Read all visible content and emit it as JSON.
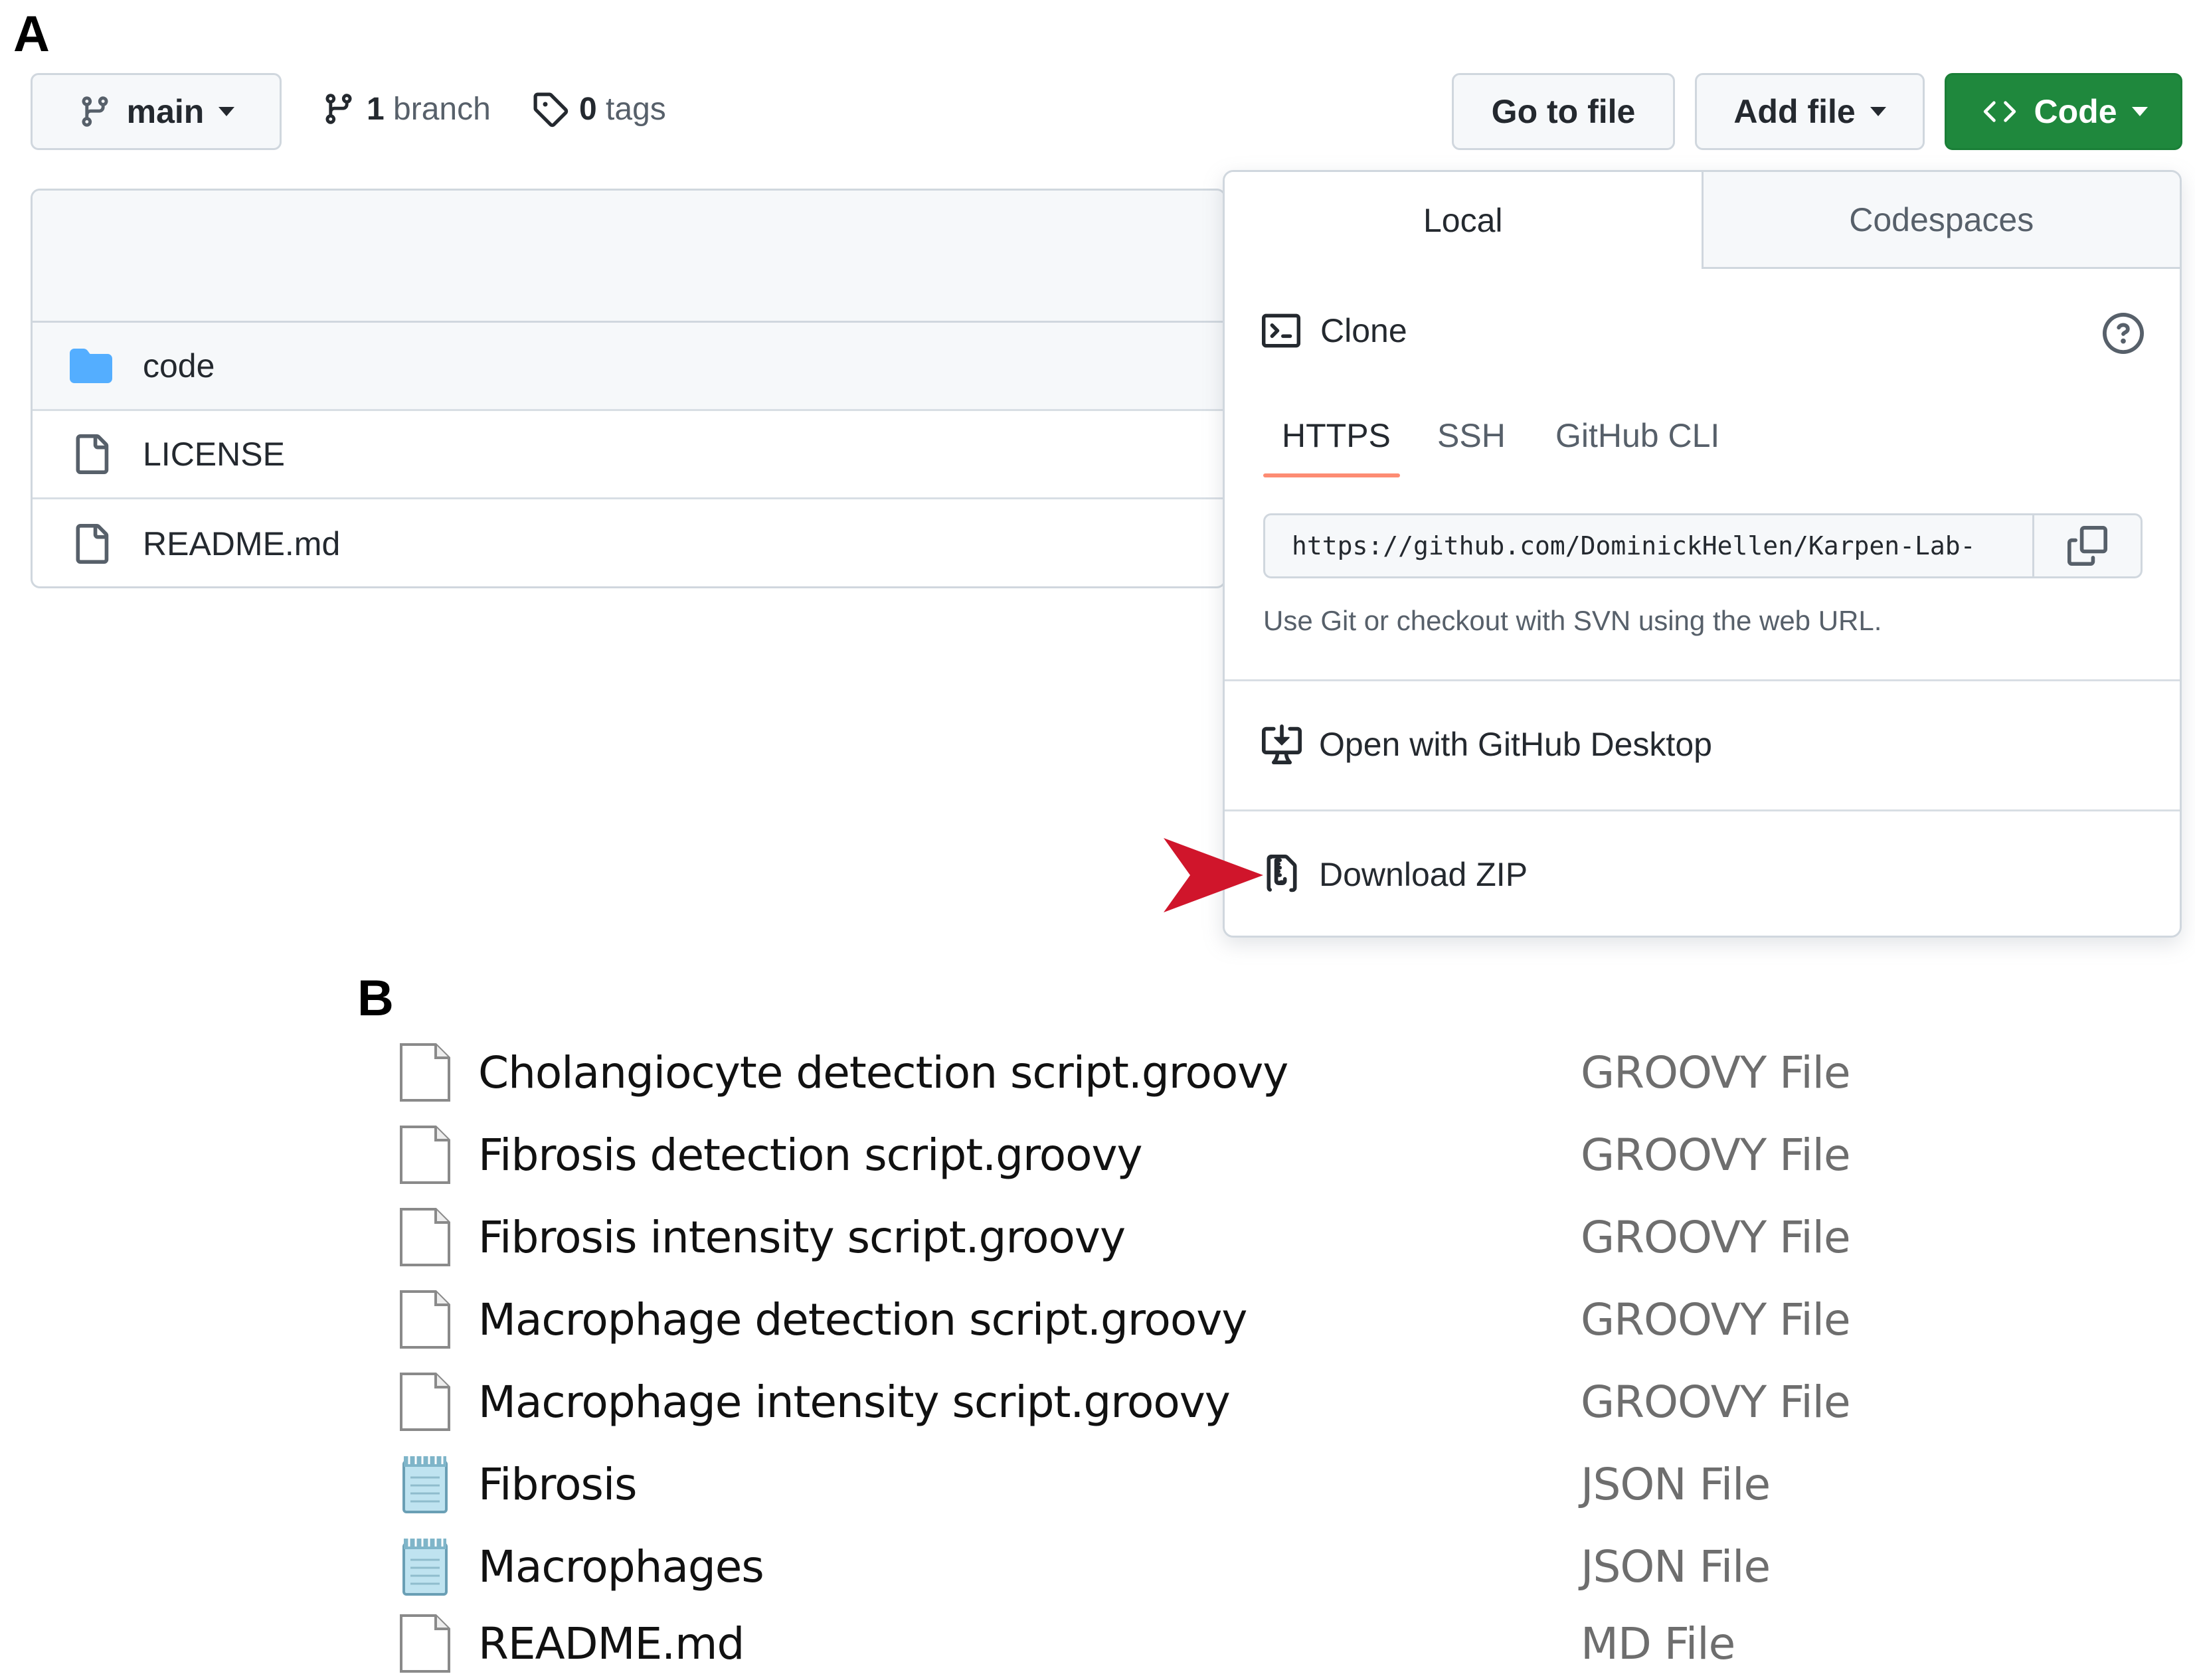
{
  "panel_a_label": "A",
  "panel_b_label": "B",
  "repo_bar": {
    "branch_selector": "main",
    "branches_count": "1",
    "branches_label": "branch",
    "tags_count": "0",
    "tags_label": "tags",
    "go_to_file": "Go to file",
    "add_file": "Add file",
    "code_button": "Code"
  },
  "file_list": [
    {
      "name": "code",
      "icon": "folder-icon"
    },
    {
      "name": "LICENSE",
      "icon": "file-icon"
    },
    {
      "name": "README.md",
      "icon": "file-icon"
    }
  ],
  "code_dropdown": {
    "tabs": [
      "Local",
      "Codespaces"
    ],
    "clone_title": "Clone",
    "protocols": [
      "HTTPS",
      "SSH",
      "GitHub CLI"
    ],
    "clone_url": "https://github.com/DominickHellen/Karpen-Lab-",
    "clone_hint": "Use Git or checkout with SVN using the web URL.",
    "open_desktop": "Open with GitHub Desktop",
    "download_zip": "Download ZIP"
  },
  "colors": {
    "accent_green": "#1f883d",
    "tab_underline": "#fd8c73",
    "folder_blue": "#54aeff",
    "arrow_red": "#d0152b"
  },
  "explorer_files": [
    {
      "name": "Cholangiocyte detection script.groovy",
      "type": "GROOVY File",
      "icon": "blank-file-icon"
    },
    {
      "name": "Fibrosis detection script.groovy",
      "type": "GROOVY File",
      "icon": "blank-file-icon"
    },
    {
      "name": "Fibrosis intensity script.groovy",
      "type": "GROOVY File",
      "icon": "blank-file-icon"
    },
    {
      "name": "Macrophage detection script.groovy",
      "type": "GROOVY File",
      "icon": "blank-file-icon"
    },
    {
      "name": "Macrophage intensity script.groovy",
      "type": "GROOVY File",
      "icon": "blank-file-icon"
    },
    {
      "name": "Fibrosis",
      "type": "JSON File",
      "icon": "notepad-icon"
    },
    {
      "name": "Macrophages",
      "type": "JSON File",
      "icon": "notepad-icon"
    },
    {
      "name": "README.md",
      "type": "MD File",
      "icon": "blank-file-icon"
    }
  ]
}
